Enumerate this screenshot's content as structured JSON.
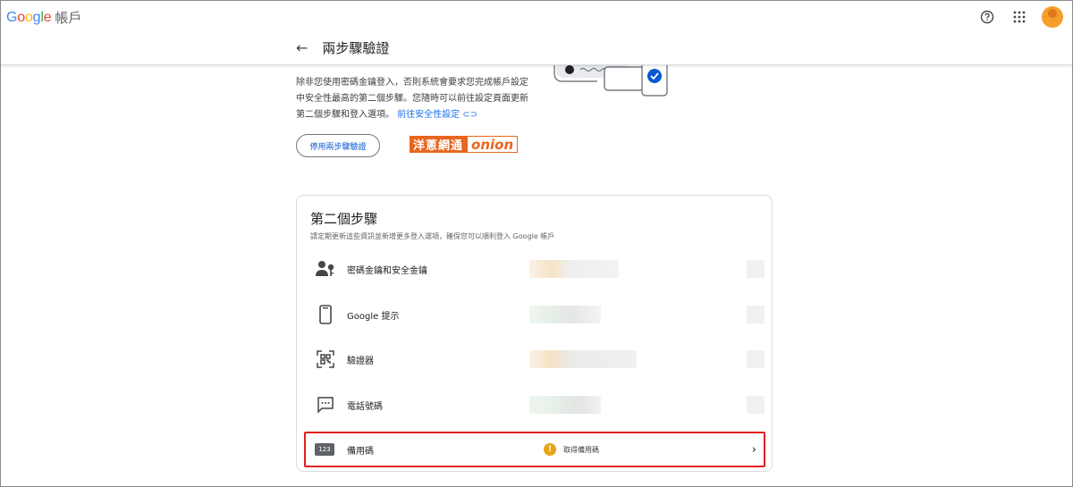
{
  "header": {
    "brand_letters": [
      {
        "ch": "G",
        "color": "#4285F4"
      },
      {
        "ch": "o",
        "color": "#EA4335"
      },
      {
        "ch": "o",
        "color": "#FBBC05"
      },
      {
        "ch": "g",
        "color": "#4285F4"
      },
      {
        "ch": "l",
        "color": "#34A853"
      },
      {
        "ch": "e",
        "color": "#EA4335"
      }
    ],
    "account_label": "帳戶",
    "icons": [
      "help-icon",
      "apps-grid-icon",
      "avatar"
    ]
  },
  "page": {
    "back_icon": "arrow-left-icon",
    "title": "兩步驟驗證"
  },
  "description": {
    "text": "除非您使用密碼金鑰登入，否則系統會要求您完成帳戶設定中安全性最高的第二個步驟。您隨時可以前往設定頁面更新第二個步驟和登入選項。",
    "link": "前往安全性設定"
  },
  "disable_button": "停用兩步驟驗證",
  "watermark": {
    "left": "洋蔥網通",
    "right": "onion"
  },
  "second_step": {
    "title": "第二個步驟",
    "subtitle": "請定期更新這些資訊並新增更多登入選項，確保您可以順利登入 Google 帳戶",
    "items": [
      {
        "label": "密碼金鑰和安全金鑰",
        "icon": "person-key-icon"
      },
      {
        "label": "Google 提示",
        "icon": "phone-icon"
      },
      {
        "label": "驗證器",
        "icon": "qr-scan-icon"
      },
      {
        "label": "電話號碼",
        "icon": "message-dots-icon"
      }
    ],
    "backup": {
      "badge": "123",
      "label": "備用碼",
      "status_icon": "warning-icon",
      "status": "取得備用碼",
      "chevron": "chevron-right-icon"
    }
  },
  "colors": {
    "accent_blue": "#1a73e8",
    "warning": "#e8a317",
    "highlight_red": "#e02020",
    "watermark_orange": "#e8651e"
  }
}
